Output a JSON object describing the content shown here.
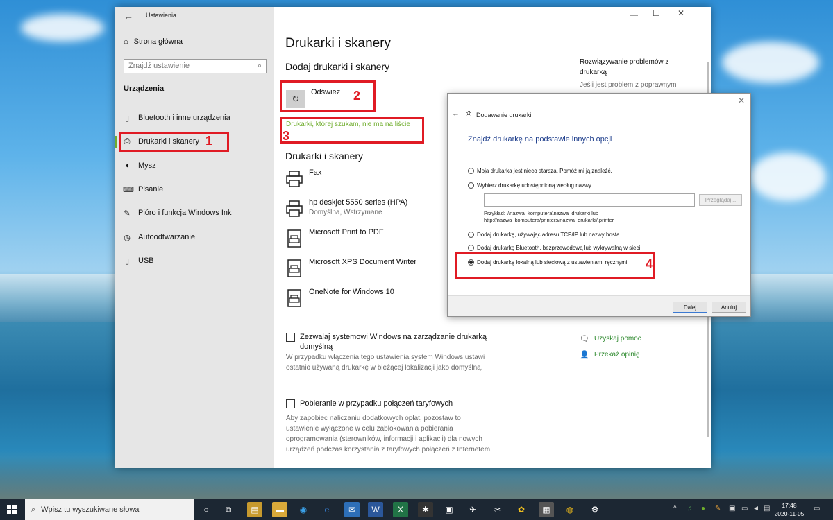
{
  "settings": {
    "title": "Ustawienia",
    "home_label": "Strona główna",
    "search_placeholder": "Znajdź ustawienie",
    "section_title": "Urządzenia",
    "nav_items": [
      {
        "label": "Bluetooth i inne urządzenia",
        "icon": "bluetooth-icon"
      },
      {
        "label": "Drukarki i skanery",
        "icon": "printer-icon",
        "active": true
      },
      {
        "label": "Mysz",
        "icon": "mouse-icon"
      },
      {
        "label": "Pisanie",
        "icon": "keyboard-icon"
      },
      {
        "label": "Pióro i funkcja Windows Ink",
        "icon": "pen-icon"
      },
      {
        "label": "Autoodtwarzanie",
        "icon": "autoplay-icon"
      },
      {
        "label": "USB",
        "icon": "usb-icon"
      }
    ]
  },
  "main": {
    "page_title": "Drukarki i skanery",
    "add_section_title": "Dodaj drukarki i skanery",
    "refresh_label": "Odśwież",
    "not_listed_link": "Drukarki, której szukam, nie ma na liście",
    "printers_title": "Drukarki i skanery",
    "printers": [
      {
        "name": "Fax",
        "status": ""
      },
      {
        "name": "hp deskjet 5550 series (HPA)",
        "status": "Domyślna, Wstrzymane"
      },
      {
        "name": "Microsoft Print to PDF",
        "status": ""
      },
      {
        "name": "Microsoft XPS Document Writer",
        "status": ""
      },
      {
        "name": "OneNote for Windows 10",
        "status": ""
      }
    ],
    "option_default_mgmt": {
      "label_line1": "Zezwalaj systemowi Windows na zarządzanie drukarką",
      "label_line2": "domyślną",
      "desc_line1": "W przypadku włączenia tego ustawienia system Windows ustawi",
      "desc_line2": "ostatnio używaną drukarkę w bieżącej lokalizacji jako domyślną.",
      "checked": false
    },
    "option_metered": {
      "label": "Pobieranie w przypadku połączeń taryfowych",
      "desc_line1": "Aby zapobiec naliczaniu dodatkowych opłat, pozostaw to",
      "desc_line2": "ustawienie wyłączone w celu zablokowania pobierania",
      "desc_line3": "oprogramowania (sterowników, informacji i aplikacji) dla nowych",
      "desc_line4": "urządzeń podczas korzystania z taryfowych połączeń z Internetem.",
      "checked": false
    },
    "right_panel": {
      "troubleshoot_line1": "Rozwiązywanie problemów z",
      "troubleshoot_line2": "drukarką",
      "troubleshoot_desc": "Jeśli jest problem z poprawnym",
      "help_link": "Uzyskaj pomoc",
      "feedback_link": "Przekaż opinię"
    }
  },
  "dialog": {
    "title": "Dodawanie drukarki",
    "heading": "Znajdź drukarkę na podstawie innych opcji",
    "options": [
      {
        "label": "Moja drukarka jest nieco starsza. Pomóż mi ją znaleźć.",
        "selected": false
      },
      {
        "label": "Wybierz drukarkę udostępnioną według nazwy",
        "selected": false
      },
      {
        "label": "Dodaj drukarkę, używając adresu TCP/IP lub nazwy hosta",
        "selected": false
      },
      {
        "label": "Dodaj drukarkę Bluetooth, bezprzewodową lub wykrywalną w sieci",
        "selected": false
      },
      {
        "label": "Dodaj drukarkę lokalną lub sieciową z ustawieniami ręcznymi",
        "selected": true
      }
    ],
    "name_input_value": "",
    "browse_button": "Przeglądaj...",
    "example_line1": "Przykład: \\\\nazwa_komputera\\nazwa_drukarki lub",
    "example_line2": "http://nazwa_komputera/printers/nazwa_drukarki/.printer",
    "next_button": "Dalej",
    "cancel_button": "Anuluj"
  },
  "annotations": [
    "1",
    "2",
    "3",
    "4"
  ],
  "taskbar": {
    "search_placeholder": "Wpisz tu wyszukiwane słowa",
    "time": "17:48",
    "date": "2020-11-05"
  },
  "colors": {
    "accent_green": "#6fad2c",
    "annotation_red": "#e01b24",
    "dialog_heading": "#1e3e8c"
  }
}
